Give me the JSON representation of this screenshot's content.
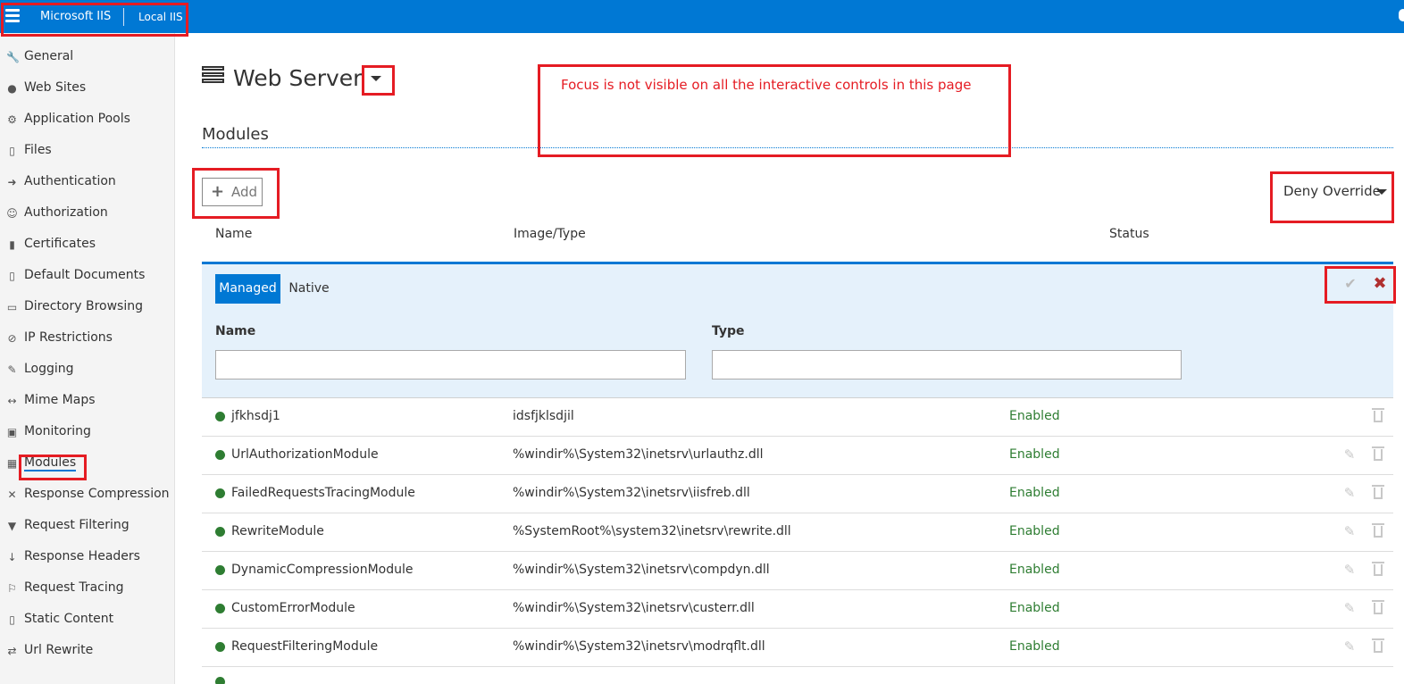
{
  "topbar": {
    "app_title": "Microsoft IIS",
    "server_name": "Local IIS"
  },
  "sidebar": {
    "items": [
      {
        "label": "General",
        "icon": "wrench-icon",
        "glyph": "🔧"
      },
      {
        "label": "Web Sites",
        "icon": "globe-icon",
        "glyph": "●"
      },
      {
        "label": "Application Pools",
        "icon": "gears-icon",
        "glyph": "⚙"
      },
      {
        "label": "Files",
        "icon": "files-icon",
        "glyph": "▯"
      },
      {
        "label": "Authentication",
        "icon": "sign-in-icon",
        "glyph": "➜"
      },
      {
        "label": "Authorization",
        "icon": "user-icon",
        "glyph": "☺"
      },
      {
        "label": "Certificates",
        "icon": "lock-icon",
        "glyph": "▮"
      },
      {
        "label": "Default Documents",
        "icon": "document-icon",
        "glyph": "▯"
      },
      {
        "label": "Directory Browsing",
        "icon": "folder-open-icon",
        "glyph": "▭"
      },
      {
        "label": "IP Restrictions",
        "icon": "ban-icon",
        "glyph": "⊘"
      },
      {
        "label": "Logging",
        "icon": "pencil-icon",
        "glyph": "✎"
      },
      {
        "label": "Mime Maps",
        "icon": "arrows-h-icon",
        "glyph": "↔"
      },
      {
        "label": "Monitoring",
        "icon": "medkit-icon",
        "glyph": "▣"
      },
      {
        "label": "Modules",
        "icon": "grid-icon",
        "glyph": "▦"
      },
      {
        "label": "Response Compression",
        "icon": "compress-icon",
        "glyph": "✕"
      },
      {
        "label": "Request Filtering",
        "icon": "filter-icon",
        "glyph": "▼"
      },
      {
        "label": "Response Headers",
        "icon": "arrow-down-icon",
        "glyph": "↓"
      },
      {
        "label": "Request Tracing",
        "icon": "flag-icon",
        "glyph": "⚐"
      },
      {
        "label": "Static Content",
        "icon": "file-icon",
        "glyph": "▯"
      },
      {
        "label": "Url Rewrite",
        "icon": "exchange-icon",
        "glyph": "⇄"
      }
    ]
  },
  "page": {
    "title": "Web Server",
    "section_title": "Modules",
    "add_label": "Add",
    "policy_label": "Deny Override"
  },
  "table": {
    "headers": [
      "Name",
      "Image/Type",
      "Status"
    ],
    "edit_panel": {
      "tab_managed": "Managed",
      "tab_native": "Native",
      "name_label": "Name",
      "type_label": "Type",
      "name_value": "",
      "type_value": ""
    },
    "rows": [
      {
        "name": "jfkhsdj1",
        "image": "idsfjklsdjil",
        "status": "Enabled",
        "editable": false
      },
      {
        "name": "UrlAuthorizationModule",
        "image": "%windir%\\System32\\inetsrv\\urlauthz.dll",
        "status": "Enabled",
        "editable": true
      },
      {
        "name": "FailedRequestsTracingModule",
        "image": "%windir%\\System32\\inetsrv\\iisfreb.dll",
        "status": "Enabled",
        "editable": true
      },
      {
        "name": "RewriteModule",
        "image": "%SystemRoot%\\system32\\inetsrv\\rewrite.dll",
        "status": "Enabled",
        "editable": true
      },
      {
        "name": "DynamicCompressionModule",
        "image": "%windir%\\System32\\inetsrv\\compdyn.dll",
        "status": "Enabled",
        "editable": true
      },
      {
        "name": "CustomErrorModule",
        "image": "%windir%\\System32\\inetsrv\\custerr.dll",
        "status": "Enabled",
        "editable": true
      },
      {
        "name": "RequestFilteringModule",
        "image": "%windir%\\System32\\inetsrv\\modrqflt.dll",
        "status": "Enabled",
        "editable": true
      }
    ]
  },
  "annotation": {
    "text": "Focus is not visible on all the interactive controls in this page"
  },
  "colors": {
    "accent": "#0078d4",
    "annotation": "#e51c23",
    "status_enabled": "#2e7d32"
  }
}
